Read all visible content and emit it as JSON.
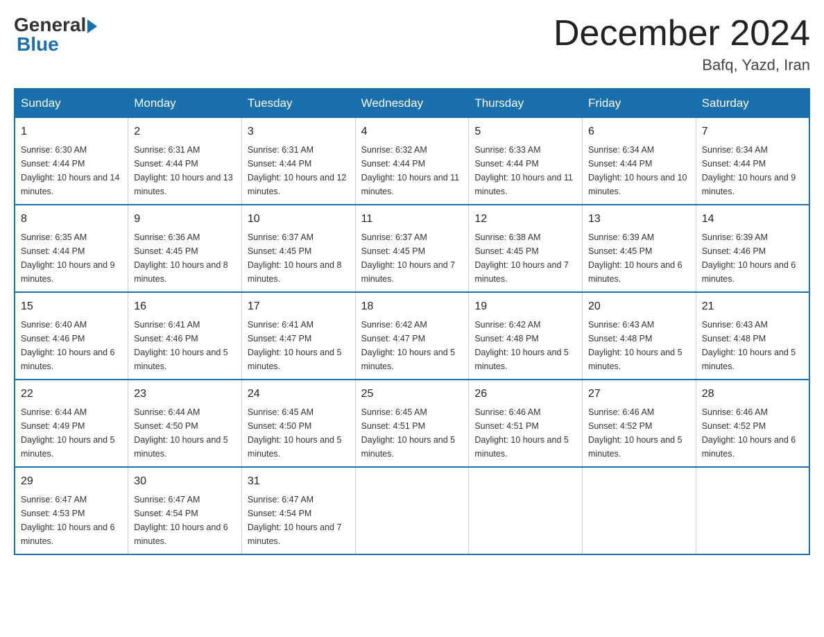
{
  "header": {
    "logo_general": "General",
    "logo_blue": "Blue",
    "month_title": "December 2024",
    "location": "Bafq, Yazd, Iran"
  },
  "days_of_week": [
    "Sunday",
    "Monday",
    "Tuesday",
    "Wednesday",
    "Thursday",
    "Friday",
    "Saturday"
  ],
  "weeks": [
    [
      {
        "day": "1",
        "sunrise": "6:30 AM",
        "sunset": "4:44 PM",
        "daylight": "10 hours and 14 minutes."
      },
      {
        "day": "2",
        "sunrise": "6:31 AM",
        "sunset": "4:44 PM",
        "daylight": "10 hours and 13 minutes."
      },
      {
        "day": "3",
        "sunrise": "6:31 AM",
        "sunset": "4:44 PM",
        "daylight": "10 hours and 12 minutes."
      },
      {
        "day": "4",
        "sunrise": "6:32 AM",
        "sunset": "4:44 PM",
        "daylight": "10 hours and 11 minutes."
      },
      {
        "day": "5",
        "sunrise": "6:33 AM",
        "sunset": "4:44 PM",
        "daylight": "10 hours and 11 minutes."
      },
      {
        "day": "6",
        "sunrise": "6:34 AM",
        "sunset": "4:44 PM",
        "daylight": "10 hours and 10 minutes."
      },
      {
        "day": "7",
        "sunrise": "6:34 AM",
        "sunset": "4:44 PM",
        "daylight": "10 hours and 9 minutes."
      }
    ],
    [
      {
        "day": "8",
        "sunrise": "6:35 AM",
        "sunset": "4:44 PM",
        "daylight": "10 hours and 9 minutes."
      },
      {
        "day": "9",
        "sunrise": "6:36 AM",
        "sunset": "4:45 PM",
        "daylight": "10 hours and 8 minutes."
      },
      {
        "day": "10",
        "sunrise": "6:37 AM",
        "sunset": "4:45 PM",
        "daylight": "10 hours and 8 minutes."
      },
      {
        "day": "11",
        "sunrise": "6:37 AM",
        "sunset": "4:45 PM",
        "daylight": "10 hours and 7 minutes."
      },
      {
        "day": "12",
        "sunrise": "6:38 AM",
        "sunset": "4:45 PM",
        "daylight": "10 hours and 7 minutes."
      },
      {
        "day": "13",
        "sunrise": "6:39 AM",
        "sunset": "4:45 PM",
        "daylight": "10 hours and 6 minutes."
      },
      {
        "day": "14",
        "sunrise": "6:39 AM",
        "sunset": "4:46 PM",
        "daylight": "10 hours and 6 minutes."
      }
    ],
    [
      {
        "day": "15",
        "sunrise": "6:40 AM",
        "sunset": "4:46 PM",
        "daylight": "10 hours and 6 minutes."
      },
      {
        "day": "16",
        "sunrise": "6:41 AM",
        "sunset": "4:46 PM",
        "daylight": "10 hours and 5 minutes."
      },
      {
        "day": "17",
        "sunrise": "6:41 AM",
        "sunset": "4:47 PM",
        "daylight": "10 hours and 5 minutes."
      },
      {
        "day": "18",
        "sunrise": "6:42 AM",
        "sunset": "4:47 PM",
        "daylight": "10 hours and 5 minutes."
      },
      {
        "day": "19",
        "sunrise": "6:42 AM",
        "sunset": "4:48 PM",
        "daylight": "10 hours and 5 minutes."
      },
      {
        "day": "20",
        "sunrise": "6:43 AM",
        "sunset": "4:48 PM",
        "daylight": "10 hours and 5 minutes."
      },
      {
        "day": "21",
        "sunrise": "6:43 AM",
        "sunset": "4:48 PM",
        "daylight": "10 hours and 5 minutes."
      }
    ],
    [
      {
        "day": "22",
        "sunrise": "6:44 AM",
        "sunset": "4:49 PM",
        "daylight": "10 hours and 5 minutes."
      },
      {
        "day": "23",
        "sunrise": "6:44 AM",
        "sunset": "4:50 PM",
        "daylight": "10 hours and 5 minutes."
      },
      {
        "day": "24",
        "sunrise": "6:45 AM",
        "sunset": "4:50 PM",
        "daylight": "10 hours and 5 minutes."
      },
      {
        "day": "25",
        "sunrise": "6:45 AM",
        "sunset": "4:51 PM",
        "daylight": "10 hours and 5 minutes."
      },
      {
        "day": "26",
        "sunrise": "6:46 AM",
        "sunset": "4:51 PM",
        "daylight": "10 hours and 5 minutes."
      },
      {
        "day": "27",
        "sunrise": "6:46 AM",
        "sunset": "4:52 PM",
        "daylight": "10 hours and 5 minutes."
      },
      {
        "day": "28",
        "sunrise": "6:46 AM",
        "sunset": "4:52 PM",
        "daylight": "10 hours and 6 minutes."
      }
    ],
    [
      {
        "day": "29",
        "sunrise": "6:47 AM",
        "sunset": "4:53 PM",
        "daylight": "10 hours and 6 minutes."
      },
      {
        "day": "30",
        "sunrise": "6:47 AM",
        "sunset": "4:54 PM",
        "daylight": "10 hours and 6 minutes."
      },
      {
        "day": "31",
        "sunrise": "6:47 AM",
        "sunset": "4:54 PM",
        "daylight": "10 hours and 7 minutes."
      },
      null,
      null,
      null,
      null
    ]
  ],
  "labels": {
    "sunrise": "Sunrise:",
    "sunset": "Sunset:",
    "daylight": "Daylight:"
  }
}
